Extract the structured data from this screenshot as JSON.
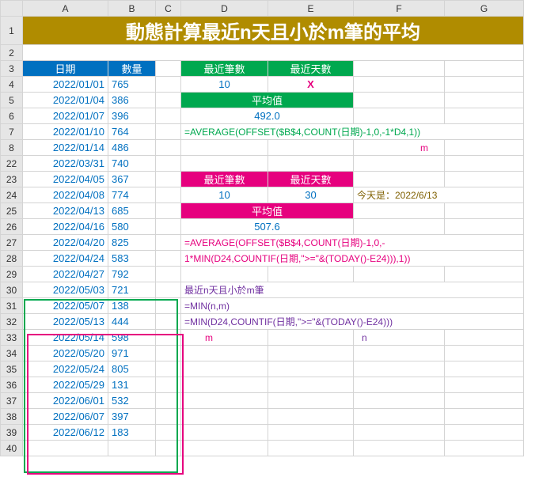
{
  "cols": [
    "A",
    "B",
    "C",
    "D",
    "E",
    "F",
    "G"
  ],
  "rows": [
    "1",
    "2",
    "3",
    "4",
    "5",
    "6",
    "7",
    "8",
    "22",
    "23",
    "24",
    "25",
    "26",
    "27",
    "28",
    "29",
    "30",
    "31",
    "32",
    "33",
    "34",
    "35",
    "36",
    "37",
    "38",
    "39",
    "40"
  ],
  "title": "動態計算最近n天且小於m筆的平均",
  "head": {
    "date": "日期",
    "qty": "數量"
  },
  "data": [
    {
      "d": "2022/01/01",
      "q": "765"
    },
    {
      "d": "2022/01/04",
      "q": "386"
    },
    {
      "d": "2022/01/07",
      "q": "396"
    },
    {
      "d": "2022/01/10",
      "q": "764"
    },
    {
      "d": "2022/01/14",
      "q": "486"
    },
    {
      "d": "2022/03/31",
      "q": "740"
    },
    {
      "d": "2022/04/05",
      "q": "367"
    },
    {
      "d": "2022/04/08",
      "q": "774"
    },
    {
      "d": "2022/04/13",
      "q": "685"
    },
    {
      "d": "2022/04/16",
      "q": "580"
    },
    {
      "d": "2022/04/20",
      "q": "825"
    },
    {
      "d": "2022/04/24",
      "q": "583"
    },
    {
      "d": "2022/04/27",
      "q": "792"
    },
    {
      "d": "2022/05/03",
      "q": "721"
    },
    {
      "d": "2022/05/07",
      "q": "138"
    },
    {
      "d": "2022/05/13",
      "q": "444"
    },
    {
      "d": "2022/05/14",
      "q": "598"
    },
    {
      "d": "2022/05/20",
      "q": "971"
    },
    {
      "d": "2022/05/24",
      "q": "805"
    },
    {
      "d": "2022/05/29",
      "q": "131"
    },
    {
      "d": "2022/06/01",
      "q": "532"
    },
    {
      "d": "2022/06/07",
      "q": "397"
    },
    {
      "d": "2022/06/12",
      "q": "183"
    }
  ],
  "g": {
    "recN": "最近筆數",
    "recD": "最近天數",
    "avg": "平均值",
    "v1": "10",
    "v2": "X",
    "v3": "492.0"
  },
  "p": {
    "v1": "10",
    "v2": "30",
    "v3": "507.6",
    "today": "今天是：2022/6/13"
  },
  "f": {
    "g": "=AVERAGE(OFFSET($B$4,COUNT(日期)-1,0,-1*D4,1))",
    "gm": "m",
    "p1": "=AVERAGE(OFFSET($B$4,COUNT(日期)-1,0,-",
    "p2": "1*MIN(D24,COUNTIF(日期,\">=\"&(TODAY()-E24))),1))",
    "pt": "最近n天且小於m筆",
    "pm": "=MIN(n,m)",
    "pf": "=MIN(D24,COUNTIF(日期,\">=\"&(TODAY()-E24)))",
    "m": "m",
    "n": "n"
  }
}
